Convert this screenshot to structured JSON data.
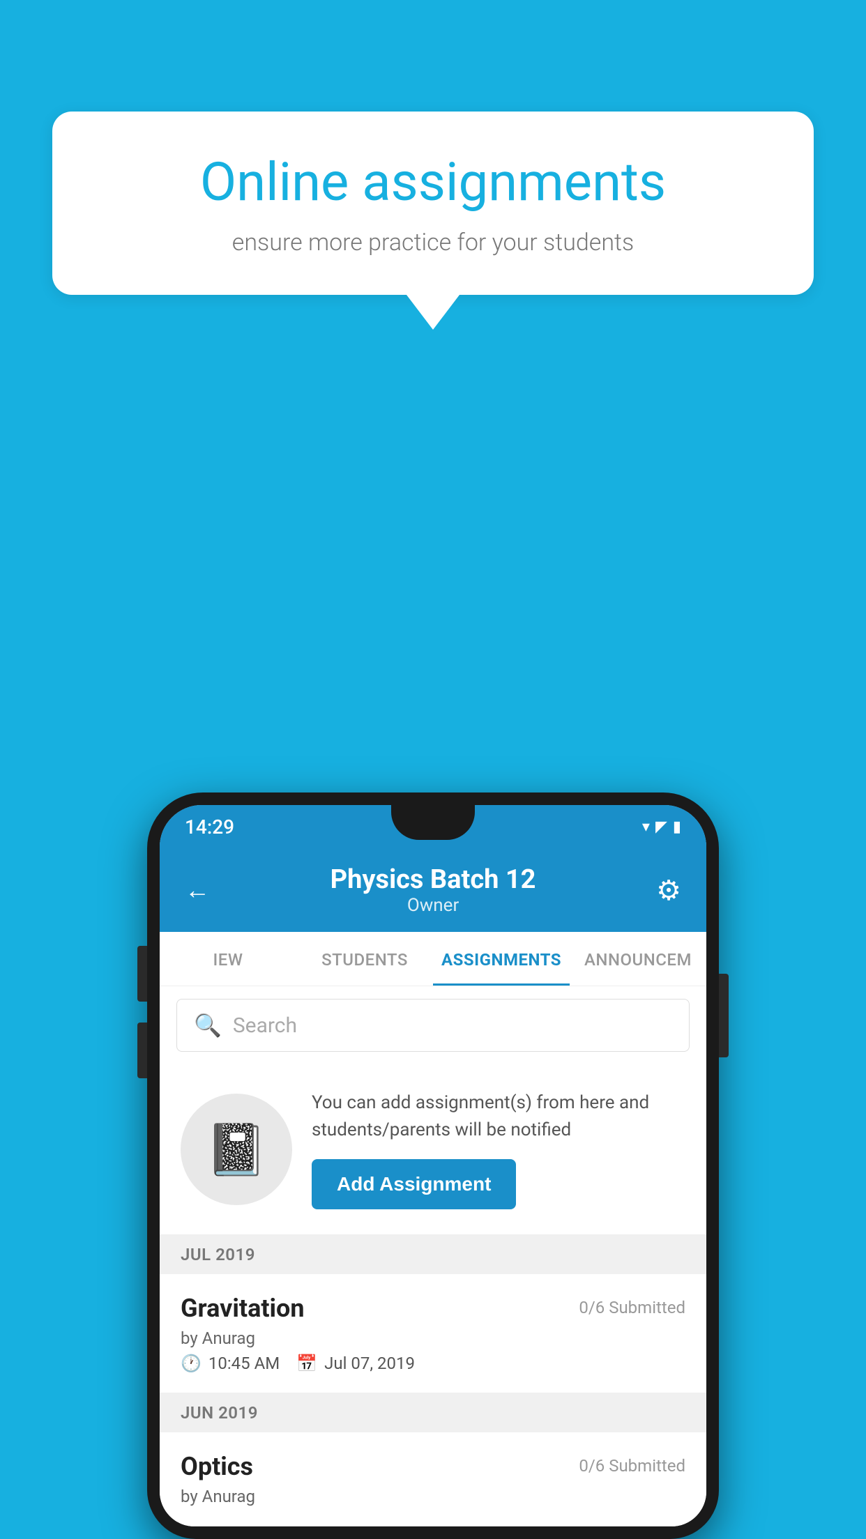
{
  "background_color": "#17b0e0",
  "speech_bubble": {
    "title": "Online assignments",
    "subtitle": "ensure more practice for your students"
  },
  "status_bar": {
    "time": "14:29",
    "wifi": "▾",
    "signal": "▲",
    "battery": "▮"
  },
  "header": {
    "title": "Physics Batch 12",
    "subtitle": "Owner",
    "back_label": "←",
    "gear_label": "⚙"
  },
  "tabs": [
    {
      "label": "IEW",
      "active": false
    },
    {
      "label": "STUDENTS",
      "active": false
    },
    {
      "label": "ASSIGNMENTS",
      "active": true
    },
    {
      "label": "ANNOUNCEM",
      "active": false
    }
  ],
  "search": {
    "placeholder": "Search"
  },
  "promo": {
    "description": "You can add assignment(s) from here and students/parents will be notified",
    "button_label": "Add Assignment"
  },
  "sections": [
    {
      "label": "JUL 2019",
      "assignments": [
        {
          "name": "Gravitation",
          "submitted": "0/6 Submitted",
          "by": "by Anurag",
          "time": "10:45 AM",
          "date": "Jul 07, 2019"
        }
      ]
    },
    {
      "label": "JUN 2019",
      "assignments": [
        {
          "name": "Optics",
          "submitted": "0/6 Submitted",
          "by": "by Anurag",
          "time": "",
          "date": ""
        }
      ]
    }
  ]
}
